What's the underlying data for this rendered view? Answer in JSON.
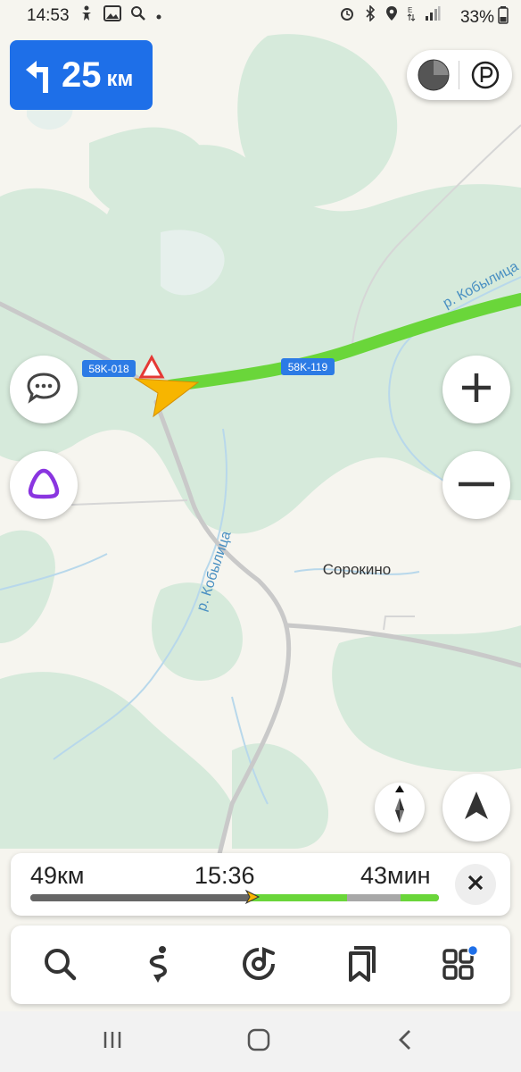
{
  "status_bar": {
    "time": "14:53",
    "battery": "33%",
    "left_icons": [
      "accessibility-icon",
      "gallery-icon",
      "search-icon",
      "dot-icon"
    ],
    "right_icons": [
      "alarm-icon",
      "bluetooth-icon",
      "location-icon",
      "signal-e-icon",
      "signal-icon"
    ]
  },
  "maneuver": {
    "turn": "turn-left-icon",
    "distance": "25",
    "unit": "км"
  },
  "map": {
    "road_labels": {
      "road_a": "58K-018",
      "road_b": "58K-119"
    },
    "river_labels": {
      "upper": "р. Кобылица",
      "lower": "р. Кобылица"
    },
    "village": "Сорокино"
  },
  "route_bar": {
    "distance": "49км",
    "arrival": "15:36",
    "duration": "43мин",
    "progress": 0.53
  },
  "tab_bar": {
    "tabs": [
      "search-icon",
      "route-icon",
      "music-icon",
      "bookmarks-icon",
      "services-icon"
    ]
  },
  "colors": {
    "route": "#6ad63a",
    "accent": "#1e6fe8",
    "assistant": "#8a35e0",
    "forest": "#d7ebdd",
    "water": "#c7e0ee"
  }
}
